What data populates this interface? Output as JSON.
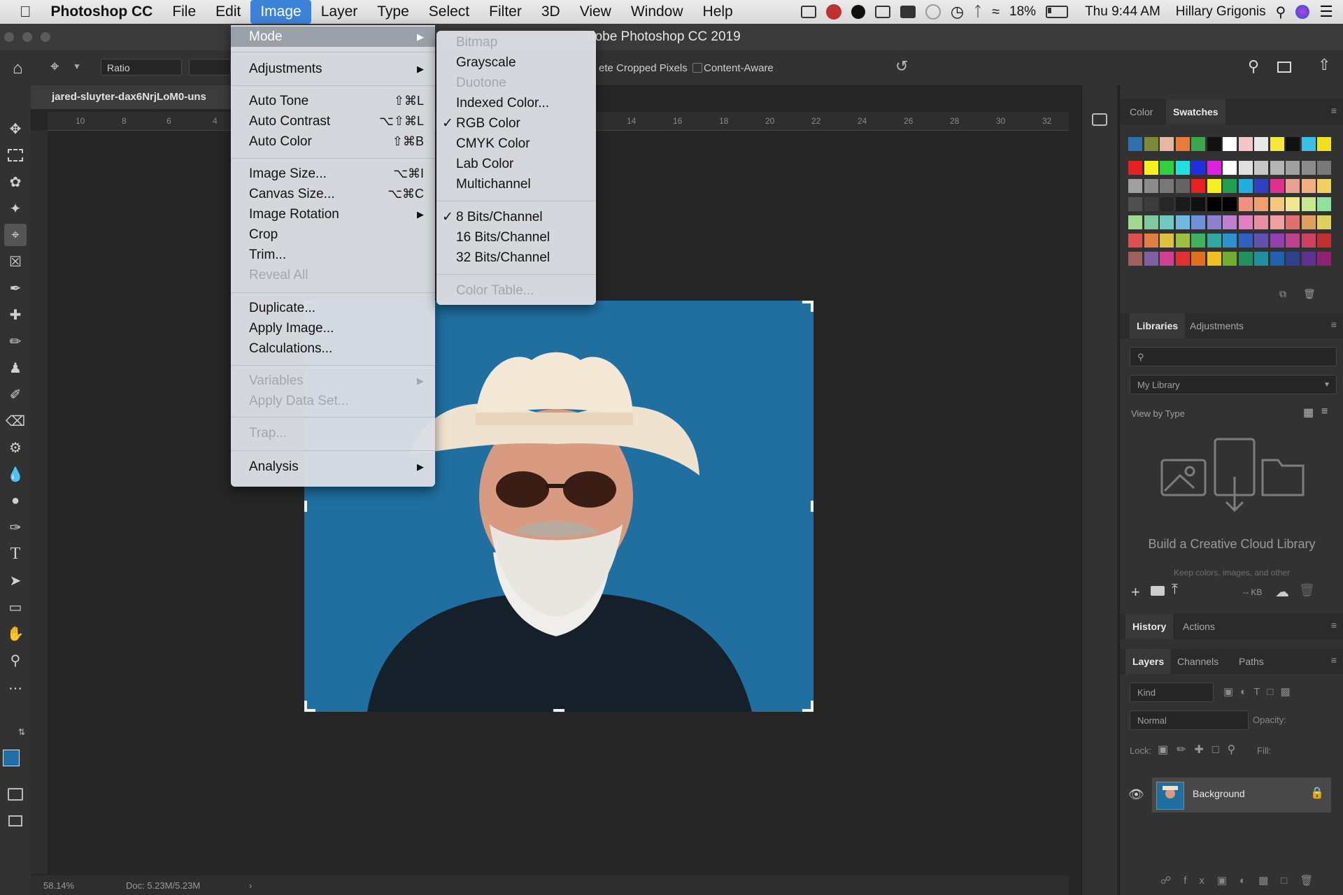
{
  "macbar": {
    "apple_icon": "apple-icon",
    "app": "Photoshop CC",
    "menus": [
      "File",
      "Edit",
      "Image",
      "Layer",
      "Type",
      "Select",
      "Filter",
      "3D",
      "View",
      "Window",
      "Help"
    ],
    "active_menu": "Image",
    "battery": "18%",
    "clock": "Thu 9:44 AM",
    "user": "Hillary Grigonis"
  },
  "window": {
    "title": "dobe Photoshop CC 2019"
  },
  "options_bar": {
    "ratio_label": "Ratio",
    "delete_cropped": "ete Cropped Pixels",
    "content_aware": "Content-Aware"
  },
  "document": {
    "tab_title": "jared-sluyter-dax6NrjLoM0-uns",
    "zoom": "58.14%",
    "doc_size": "Doc: 5.23M/5.23M",
    "ruler_ticks": [
      "10",
      "8",
      "6",
      "4",
      "14",
      "16",
      "18",
      "20",
      "22",
      "24",
      "26",
      "28",
      "30",
      "32"
    ]
  },
  "image_menu": {
    "items": [
      {
        "label": "Mode",
        "arrow": true,
        "highlight": true
      },
      {
        "label": "Adjustments",
        "arrow": true
      },
      {
        "label": "Auto Tone",
        "shortcut": "⇧⌘L"
      },
      {
        "label": "Auto Contrast",
        "shortcut": "⌥⇧⌘L"
      },
      {
        "label": "Auto Color",
        "shortcut": "⇧⌘B"
      },
      {
        "label": "Image Size...",
        "shortcut": "⌥⌘I"
      },
      {
        "label": "Canvas Size...",
        "shortcut": "⌥⌘C"
      },
      {
        "label": "Image Rotation",
        "arrow": true
      },
      {
        "label": "Crop"
      },
      {
        "label": "Trim..."
      },
      {
        "label": "Reveal All",
        "disabled": true
      },
      {
        "label": "Duplicate..."
      },
      {
        "label": "Apply Image..."
      },
      {
        "label": "Calculations..."
      },
      {
        "label": "Variables",
        "arrow": true,
        "disabled": true
      },
      {
        "label": "Apply Data Set...",
        "disabled": true
      },
      {
        "label": "Trap...",
        "disabled": true
      },
      {
        "label": "Analysis",
        "arrow": true
      }
    ]
  },
  "mode_menu": {
    "items": [
      {
        "label": "Bitmap",
        "disabled": true
      },
      {
        "label": "Grayscale"
      },
      {
        "label": "Duotone",
        "disabled": true
      },
      {
        "label": "Indexed Color..."
      },
      {
        "label": "RGB Color",
        "checked": true
      },
      {
        "label": "CMYK Color"
      },
      {
        "label": "Lab Color"
      },
      {
        "label": "Multichannel"
      },
      {
        "label": "8 Bits/Channel",
        "checked": true
      },
      {
        "label": "16 Bits/Channel"
      },
      {
        "label": "32 Bits/Channel"
      },
      {
        "label": "Color Table...",
        "disabled": true
      }
    ]
  },
  "panels": {
    "color_tabs": [
      "Color",
      "Swatches"
    ],
    "libraries_tabs": [
      "Libraries",
      "Adjustments"
    ],
    "library_select": "My Library",
    "view_by": "View by Type",
    "cc_title": "Build a Creative Cloud Library",
    "cc_sub": "Keep colors, images, and other",
    "history_tabs": [
      "History",
      "Actions"
    ],
    "layers_tabs": [
      "Layers",
      "Channels",
      "Paths"
    ],
    "layer_filter": "Kind",
    "blend_mode": "Normal",
    "opacity": "Opacity:",
    "lock": "Lock:",
    "fill": "Fill:",
    "layer_name": "Background",
    "storage": "-- KB"
  },
  "swatch_colors": [
    "#2f6fb0",
    "#7c8a3a",
    "#e8b6a4",
    "#e97c3a",
    "#3aa84a",
    "#111111",
    "#ffffff",
    "#f2c6c6",
    "#e8e8e8",
    "#f6e83c",
    "#111111",
    "#3cc0e8",
    "#f0e020",
    "#e82020",
    "#f6f020",
    "#30d040",
    "#20e0e0",
    "#2030e0",
    "#e020e0",
    "#ffffff",
    "#e0e0e0",
    "#c8c8c8",
    "#b4b4b4",
    "#a0a0a0",
    "#8c8c8c",
    "#787878",
    "#a0a0a0",
    "#8c8c8c",
    "#787878",
    "#646464",
    "#e82020",
    "#f6f020",
    "#20a050",
    "#20b0e0",
    "#3040c0",
    "#e03090",
    "#e8a090",
    "#f0b080",
    "#f0d060",
    "#505050",
    "#3c3c3c",
    "#282828",
    "#1a1a1a",
    "#101010",
    "#000000",
    "#000000",
    "#f09080",
    "#f0a070",
    "#f0c880",
    "#f0e890",
    "#c8e890",
    "#90e0a0",
    "#a0d890",
    "#80c8a0",
    "#70c8c0",
    "#70b8e0",
    "#7090d8",
    "#9080d0",
    "#c080d0",
    "#e080c0",
    "#e890a0",
    "#f0a0a0",
    "#e07070",
    "#e0a060",
    "#e0d060",
    "#e05050",
    "#e08040",
    "#e0c040",
    "#a0c040",
    "#40b060",
    "#30a8a0",
    "#3090d0",
    "#3060c0",
    "#6050b0",
    "#9040b0",
    "#c04090",
    "#d04060",
    "#c03030",
    "#a06060",
    "#8060a0",
    "#d04090",
    "#e03030",
    "#e07020",
    "#f0c020",
    "#70b030",
    "#209060",
    "#2090a0",
    "#2060b0",
    "#304090",
    "#603090",
    "#902070"
  ]
}
